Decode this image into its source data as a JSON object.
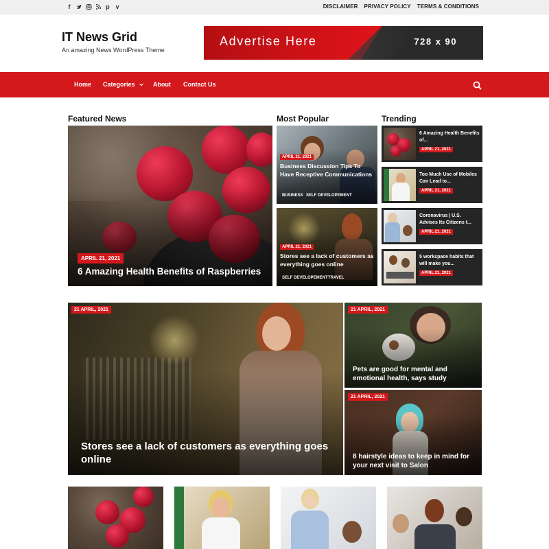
{
  "topbar": {
    "social_icons": [
      "facebook-icon",
      "twitter-icon",
      "instagram-icon",
      "rss-icon",
      "pinterest-icon",
      "vimeo-icon"
    ],
    "links": [
      "DISCLAIMER",
      "PRIVACY POLICY",
      "TERMS & CONDITIONS"
    ]
  },
  "header": {
    "title": "IT News Grid",
    "tagline": "An amazing News WordPress Theme",
    "ad_text": "Advertise Here",
    "ad_size": "728 x 90"
  },
  "nav": {
    "items": [
      "Home",
      "Categories",
      "About",
      "Contact Us"
    ],
    "search_icon": "search-icon"
  },
  "sections": {
    "featured": "Featured News",
    "popular": "Most Popular",
    "trending": "Trending"
  },
  "featured": {
    "date": "APRIL 21, 2021",
    "title": "6 Amazing Health Benefits of Raspberries"
  },
  "popular": [
    {
      "date": "APRIL 21, 2021",
      "title": "Business Discussion Tips To Have Receptive Communications",
      "tags": [
        "BUSINESS",
        "SELF DEVELOPEMENT"
      ]
    },
    {
      "date": "APRIL 21, 2021",
      "title": "Stores see a lack of customers as everything goes online",
      "tags": [
        "SELF DEVELOPEMENT",
        "TRAVEL"
      ]
    }
  ],
  "trending": [
    {
      "title": "6 Amazing Health Benefits of...",
      "date": "APRIL 21, 2021"
    },
    {
      "title": "Too Much Use of Mobiles Can Lead to...",
      "date": "APRIL 21, 2021"
    },
    {
      "title": "Coronavirus | U.S. Advises Its Citizens t...",
      "date": "APRIL 21, 2021"
    },
    {
      "title": "5 workspace habits that will make you...",
      "date": "APRIL 21, 2021"
    }
  ],
  "grid": {
    "big": {
      "date": "21 APRIL, 2021",
      "title": "Stores see a lack of customers as everything goes online"
    },
    "small": [
      {
        "date": "21 APRIL, 2021",
        "title": "Pets are good for mental and emotional health, says study"
      },
      {
        "date": "21 APRIL, 2021",
        "title": "8 hairstyle ideas to keep in mind for your next visit to Salon"
      }
    ]
  },
  "colors": {
    "brand_red": "#d3191c",
    "dark_card": "#252525"
  }
}
